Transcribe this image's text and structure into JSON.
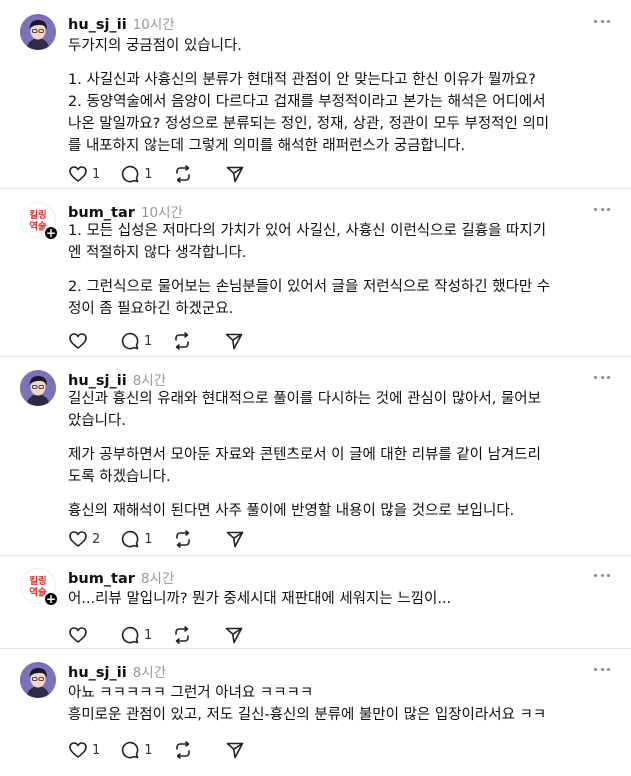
{
  "posts": [
    {
      "username": "hu_sj_ii",
      "time": "10시간",
      "avatar": "person-avatar",
      "lines": [
        "두가지의 궁금점이 있습니다.",
        "",
        "1. 사길신과 사흉신의 분류가 현대적 관점이 안 맞는다고 한신 이유가 뭘까요?",
        "2. 동양역술에서 음양이 다르다고 겁재를 부정적이라고 본가는 해석은 어디에서",
        "나온 말일까요? 정성으로 분류되는 정인, 정재, 상관, 정관이 모두 부정적인 의미",
        "를 내포하지 않는데 그렇게 의미를 해석한 래퍼런스가 궁금합니다."
      ],
      "likes": "1",
      "replies": "1",
      "reposts": "",
      "shares": ""
    },
    {
      "username": "bum_tar",
      "time": "10시간",
      "avatar": "brand-logo",
      "logo_text": [
        "킬링",
        "역술"
      ],
      "lines": [
        "1. 모든 십성은 저마다의 가치가 있어 사길신, 사흉신 이런식으로 길흉을 따지기",
        "엔 적절하지 않다 생각합니다.",
        "",
        "2. 그런식으로 물어보는 손님분들이 있어서 글을 저런식으로 작성하긴 했다만 수",
        "정이 좀 필요하긴 하겠군요."
      ],
      "likes": "",
      "replies": "1",
      "reposts": "",
      "shares": ""
    },
    {
      "username": "hu_sj_ii",
      "time": "8시간",
      "avatar": "person-avatar",
      "lines": [
        "길신과 흉신의 유래와 현대적으로 풀이를 다시하는 것에 관심이 많아서, 물어보",
        "았습니다.",
        "",
        "제가 공부하면서 모아둔 자료와 콘텐츠로서 이 글에 대한 리뷰를 같이 남겨드리",
        "도록 하겠습니다.",
        "",
        "흉신의 재해석이 된다면 사주 풀이에 반영할 내용이 많을 것으로 보입니다."
      ],
      "likes": "2",
      "replies": "1",
      "reposts": "",
      "shares": ""
    },
    {
      "username": "bum_tar",
      "time": "8시간",
      "avatar": "brand-logo",
      "logo_text": [
        "킬링",
        "역술"
      ],
      "lines": [
        "어...리뷰 말입니까? 뭔가 중세시대 재판대에 세워지는 느낌이..."
      ],
      "likes": "",
      "replies": "1",
      "reposts": "",
      "shares": ""
    },
    {
      "username": "hu_sj_ii",
      "time": "8시간",
      "avatar": "person-avatar",
      "lines": [
        "아뇨 ㅋㅋㅋㅋㅋ 그런거 아녀요 ㅋㅋㅋㅋ",
        "흥미로운 관점이 있고, 저도 길신-흉신의 분류에 불만이 많은 입장이라서요 ㅋㅋ"
      ],
      "likes": "1",
      "replies": "1",
      "reposts": "",
      "shares": ""
    }
  ],
  "colors": {
    "text": "#101010",
    "muted": "#999999",
    "logo_red": "#e0312c",
    "avatar_bg": "#7f71b9"
  }
}
